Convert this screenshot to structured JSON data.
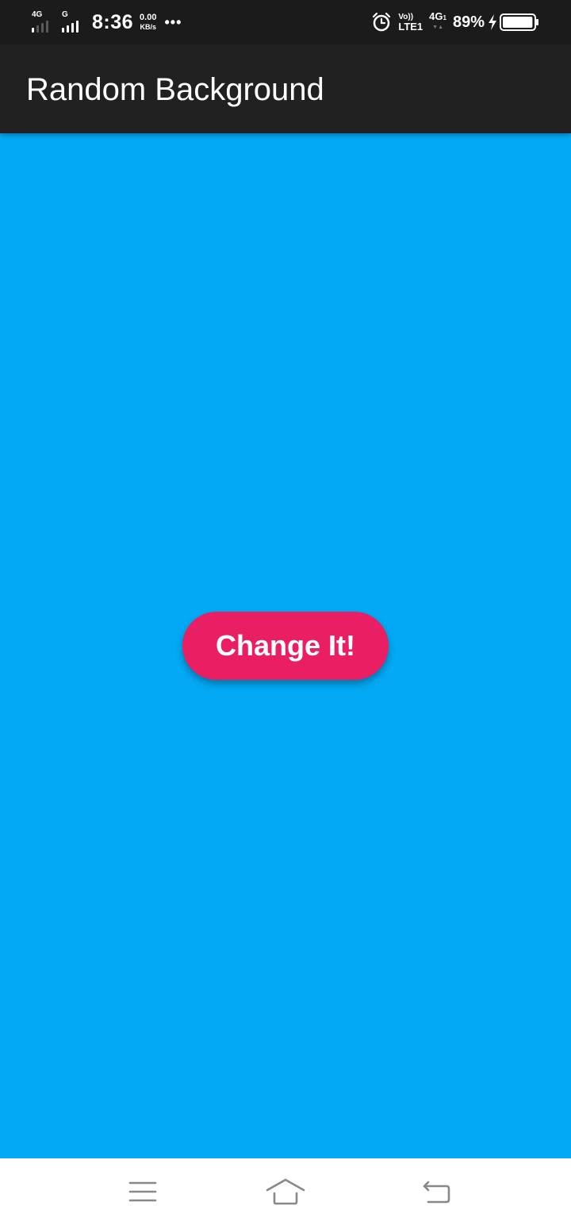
{
  "status_bar": {
    "sim1_network": "4G",
    "sim2_network": "G",
    "time": "8:36",
    "net_speed_value": "0.00",
    "net_speed_unit": "KB/s",
    "more_indicator": "•••",
    "volte_top": "Vo))",
    "volte_bottom": "LTE1",
    "data_network": "4G",
    "data_network_sub": "1",
    "data_arrows": "▼▲",
    "battery_percent": "89%",
    "battery_level": 0.89,
    "icons": [
      "alarm-icon",
      "charging-bolt-icon",
      "battery-icon"
    ]
  },
  "app_bar": {
    "title": "Random Background"
  },
  "main": {
    "background_color": "#03a9f4",
    "button_label": "Change It!",
    "button_color": "#e91e63"
  },
  "nav_bar": {
    "icons": [
      "menu-icon",
      "home-icon",
      "back-icon"
    ]
  },
  "colors": {
    "status_bar": "#1b1b1b",
    "app_bar": "#212121",
    "nav_bar": "#ffffff",
    "nav_icon": "#888888"
  }
}
